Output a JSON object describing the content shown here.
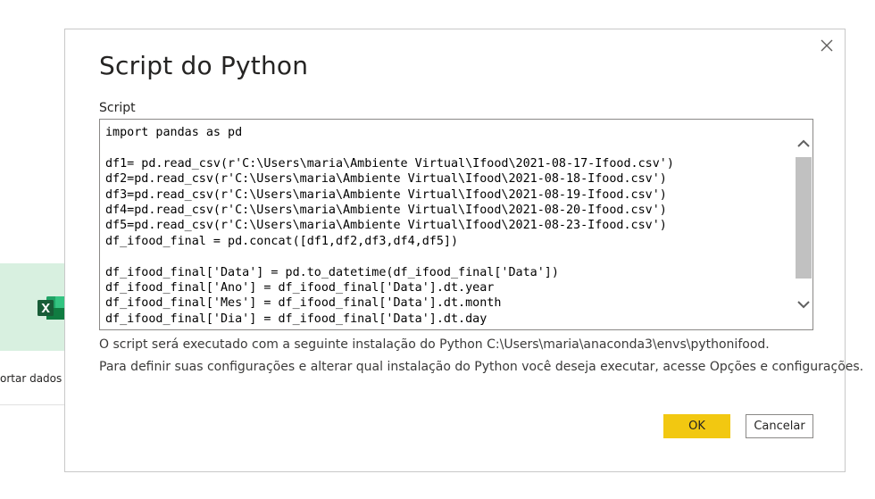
{
  "background": {
    "card_label": "ortar dados d",
    "excel_icon": "excel-icon"
  },
  "dialog": {
    "title": "Script do Python",
    "close_icon": "close-icon",
    "script_label": "Script",
    "script_code": "import pandas as pd\n\ndf1= pd.read_csv(r'C:\\Users\\maria\\Ambiente Virtual\\Ifood\\2021-08-17-Ifood.csv')\ndf2=pd.read_csv(r'C:\\Users\\maria\\Ambiente Virtual\\Ifood\\2021-08-18-Ifood.csv')\ndf3=pd.read_csv(r'C:\\Users\\maria\\Ambiente Virtual\\Ifood\\2021-08-19-Ifood.csv')\ndf4=pd.read_csv(r'C:\\Users\\maria\\Ambiente Virtual\\Ifood\\2021-08-20-Ifood.csv')\ndf5=pd.read_csv(r'C:\\Users\\maria\\Ambiente Virtual\\Ifood\\2021-08-23-Ifood.csv')\ndf_ifood_final = pd.concat([df1,df2,df3,df4,df5])\n\ndf_ifood_final['Data'] = pd.to_datetime(df_ifood_final['Data'])\ndf_ifood_final['Ano'] = df_ifood_final['Data'].dt.year\ndf_ifood_final['Mes'] = df_ifood_final['Data'].dt.month\ndf_ifood_final['Dia'] = df_ifood_final['Data'].dt.day",
    "info_install": "O script será executado com a seguinte instalação do Python C:\\Users\\maria\\anaconda3\\envs\\pythonifood.",
    "info_config": "Para definir suas configurações e alterar qual instalação do Python você deseja executar, acesse Opções e configurações.",
    "ok_label": "OK",
    "cancel_label": "Cancelar"
  },
  "colors": {
    "accent": "#f2c811",
    "text": "#252423",
    "border": "#8a8886"
  }
}
